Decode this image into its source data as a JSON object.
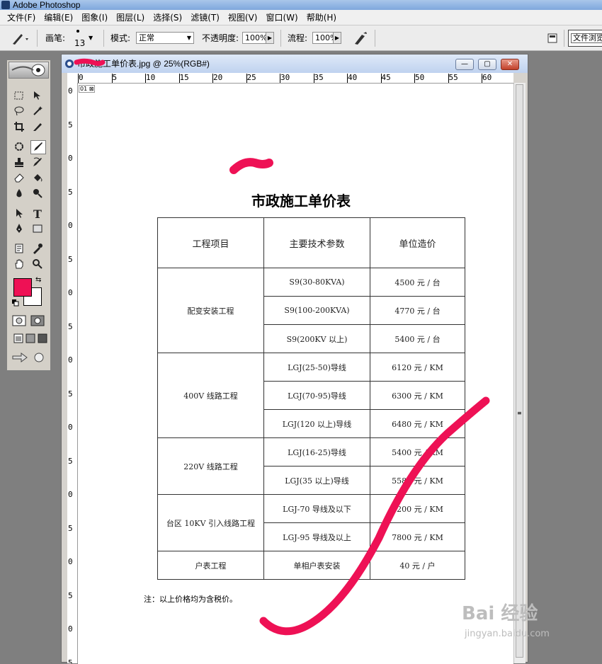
{
  "app": {
    "title": "Adobe Photoshop"
  },
  "menus": [
    "文件(F)",
    "编辑(E)",
    "图象(I)",
    "图层(L)",
    "选择(S)",
    "滤镜(T)",
    "视图(V)",
    "窗口(W)",
    "帮助(H)"
  ],
  "options_bar": {
    "brush_label": "画笔:",
    "brush_size": "13",
    "mode_label": "模式:",
    "mode_value": "正常",
    "opacity_label": "不透明度:",
    "opacity_value": "100%",
    "flow_label": "流程:",
    "flow_value": "100%",
    "file_browser_label": "文件浏览"
  },
  "toolbox": {
    "foreground_color": "#ee1155",
    "background_color": "#ffffff",
    "tools": [
      "marquee-icon",
      "move-icon",
      "lasso-icon",
      "magic-wand-icon",
      "crop-icon",
      "slice-icon",
      "healing-brush-icon",
      "brush-icon",
      "clone-stamp-icon",
      "history-brush-icon",
      "eraser-icon",
      "paint-bucket-icon",
      "blur-icon",
      "dodge-icon",
      "path-select-icon",
      "type-icon",
      "pen-icon",
      "shape-icon",
      "notes-icon",
      "eyedropper-icon",
      "hand-icon",
      "zoom-icon"
    ]
  },
  "document": {
    "title": "市政施工单价表.jpg @ 25%(RGB#)",
    "ruler_top": [
      "0",
      "5",
      "10",
      "15",
      "20",
      "25",
      "30",
      "35",
      "40",
      "45",
      "50",
      "55",
      "60"
    ],
    "ruler_left": [
      "0",
      "5",
      "0",
      "5",
      "0",
      "5",
      "0",
      "5",
      "0",
      "5",
      "0",
      "5",
      "0",
      "5",
      "0",
      "5",
      "0",
      "5"
    ],
    "heading": "市政施工单价表",
    "table": {
      "headers": [
        "工程项目",
        "主要技术参数",
        "单位造价"
      ],
      "groups": [
        {
          "project": "配变安装工程",
          "rows": [
            [
              "S9(30-80KVA)",
              "4500 元 / 台"
            ],
            [
              "S9(100-200KVA)",
              "4770 元 / 台"
            ],
            [
              "S9(200KV 以上)",
              "5400 元 / 台"
            ]
          ]
        },
        {
          "project": "400V 线路工程",
          "rows": [
            [
              "LGJ(25-50)导线",
              "6120 元 / KM"
            ],
            [
              "LGJ(70-95)导线",
              "6300 元 / KM"
            ],
            [
              "LGJ(120 以上)导线",
              "6480 元 / KM"
            ]
          ]
        },
        {
          "project": "220V 线路工程",
          "rows": [
            [
              "LGJ(16-25)导线",
              "5400 元 / KM"
            ],
            [
              "LGJ(35 以上)导线",
              "5580 元 / KM"
            ]
          ]
        },
        {
          "project": "台区 10KV 引入线路工程",
          "rows": [
            [
              "LGJ-70 导线及以下",
              "7200 元 / KM"
            ],
            [
              "LGJ-95 导线及以上",
              "7800 元 / KM"
            ]
          ]
        },
        {
          "project": "户表工程",
          "rows": [
            [
              "单相户表安装",
              "40 元 / 户"
            ]
          ]
        }
      ]
    },
    "note": "注：以上价格均为含税价。"
  },
  "watermark": {
    "main": "Bai 经验",
    "sub": "jingyan.baidu.com"
  },
  "colors": {
    "brush_stroke": "#ee1155"
  }
}
